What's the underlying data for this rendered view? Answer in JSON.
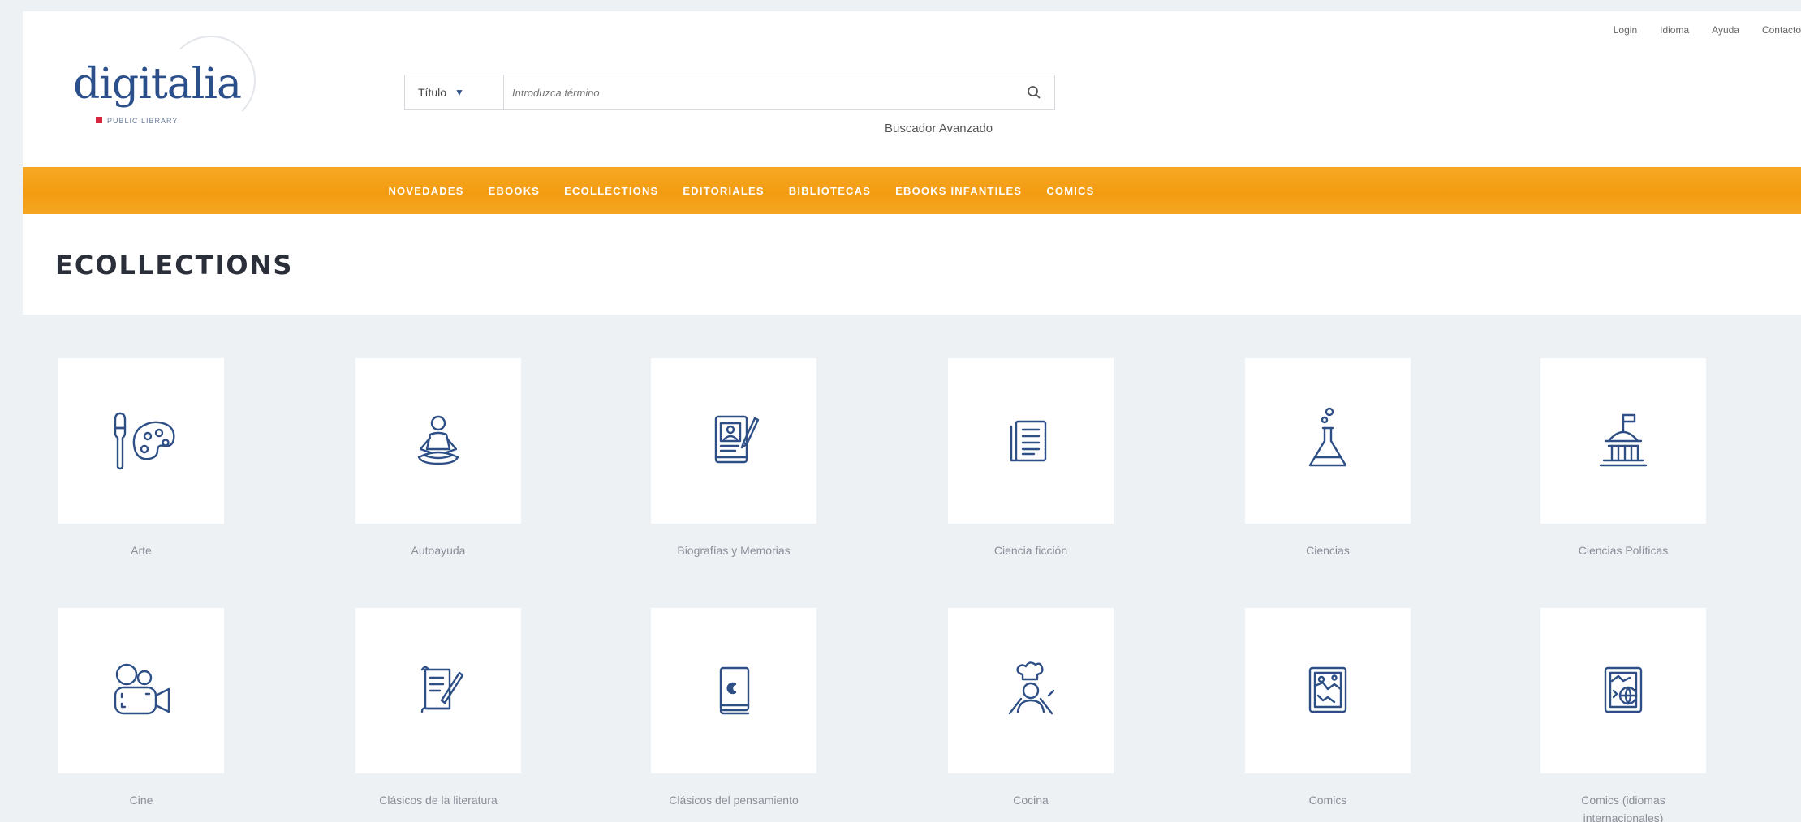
{
  "header": {
    "logo_text": "digitalia",
    "logo_subtitle": "PUBLIC LIBRARY",
    "search": {
      "field_select": "Título",
      "placeholder": "Introduzca término",
      "advanced_link": "Buscador Avanzado"
    },
    "top_links": [
      "Login",
      "Idioma",
      "Ayuda",
      "Contacto"
    ]
  },
  "nav": {
    "items": [
      "NOVEDADES",
      "EBOOKS",
      "ECOLLECTIONS",
      "EDITORIALES",
      "BIBLIOTECAS",
      "EBOOKS INFANTILES",
      "COMICS"
    ]
  },
  "page": {
    "title": "ECOLLECTIONS"
  },
  "collections": [
    {
      "label": "Arte",
      "icon": "palette-icon"
    },
    {
      "label": "Autoayuda",
      "icon": "meditation-icon"
    },
    {
      "label": "Biografías y Memorias",
      "icon": "biography-book-icon"
    },
    {
      "label": "Ciencia ficción",
      "icon": "documents-icon"
    },
    {
      "label": "Ciencias",
      "icon": "flask-icon"
    },
    {
      "label": "Ciencias Políticas",
      "icon": "capitol-building-icon"
    },
    {
      "label": "Cine",
      "icon": "film-camera-icon"
    },
    {
      "label": "Clásicos de la literatura",
      "icon": "scroll-quill-icon"
    },
    {
      "label": "Clásicos del pensamiento",
      "icon": "book-moon-icon"
    },
    {
      "label": "Cocina",
      "icon": "chef-icon"
    },
    {
      "label": "Comics",
      "icon": "comic-page-icon"
    },
    {
      "label": "Comics (idiomas internacionales)",
      "icon": "comic-globe-icon"
    }
  ],
  "colors": {
    "accent_orange": "#f39c12",
    "icon_blue": "#2e4f86",
    "logo_blue": "#2a4f8a",
    "logo_red": "#d7263d"
  }
}
